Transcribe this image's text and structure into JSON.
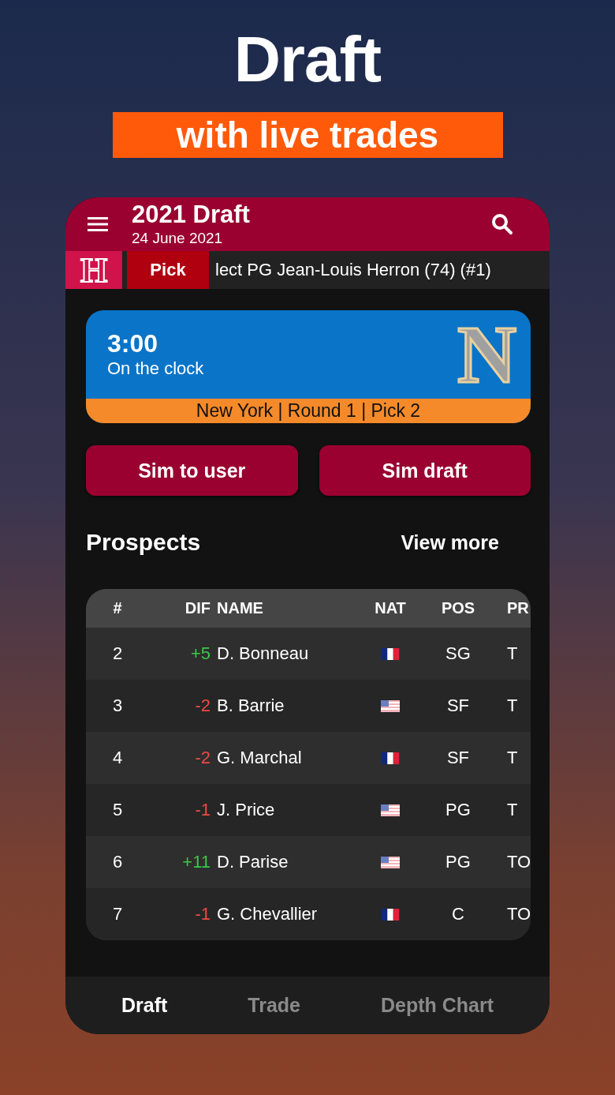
{
  "promo": {
    "headline": "Draft",
    "tagline": "with live trades"
  },
  "header": {
    "title": "2021 Draft",
    "subtitle": "24 June 2021"
  },
  "ticker": {
    "logo_letter": "H",
    "label": "Pick",
    "text": "lect PG Jean-Louis Herron (74) (#1)"
  },
  "clock": {
    "time": "3:00",
    "status": "On the clock",
    "logo_letter": "N",
    "detail": "New York | Round 1 | Pick 2"
  },
  "buttons": [
    "Sim to user",
    "Sim draft"
  ],
  "prospects": {
    "title": "Prospects",
    "link": "View more",
    "columns": [
      "#",
      "DIF",
      "NAME",
      "NAT",
      "POS",
      "PR"
    ],
    "rows": [
      {
        "rank": "2",
        "dif": "+5",
        "color": "#38c84a",
        "name": "D. Bonneau",
        "kind": "france",
        "pos": "SG",
        "column_6": "T"
      },
      {
        "rank": "3",
        "dif": "-2",
        "color": "#ee4a44",
        "name": "B. Barrie",
        "kind": "usa",
        "pos": "SF",
        "column_6": "T"
      },
      {
        "rank": "4",
        "dif": "-2",
        "color": "#ee4a44",
        "name": "G. Marchal",
        "kind": "france",
        "pos": "SF",
        "column_6": "T"
      },
      {
        "rank": "5",
        "dif": "-1",
        "color": "#ee4a44",
        "name": "J. Price",
        "kind": "usa",
        "pos": "PG",
        "column_6": "T"
      },
      {
        "rank": "6",
        "dif": "+11",
        "color": "#38c84a",
        "name": "D. Parise",
        "kind": "usa",
        "pos": "PG",
        "column_6": "TO"
      },
      {
        "rank": "7",
        "dif": "-1",
        "color": "#ee4a44",
        "name": "G. Chevallier",
        "kind": "france",
        "pos": "C",
        "column_6": "TO"
      }
    ]
  },
  "tabs": [
    {
      "label": "Draft",
      "selected": true
    },
    {
      "label": "Trade",
      "selected": false
    },
    {
      "label": "Depth Chart",
      "selected": false
    }
  ]
}
